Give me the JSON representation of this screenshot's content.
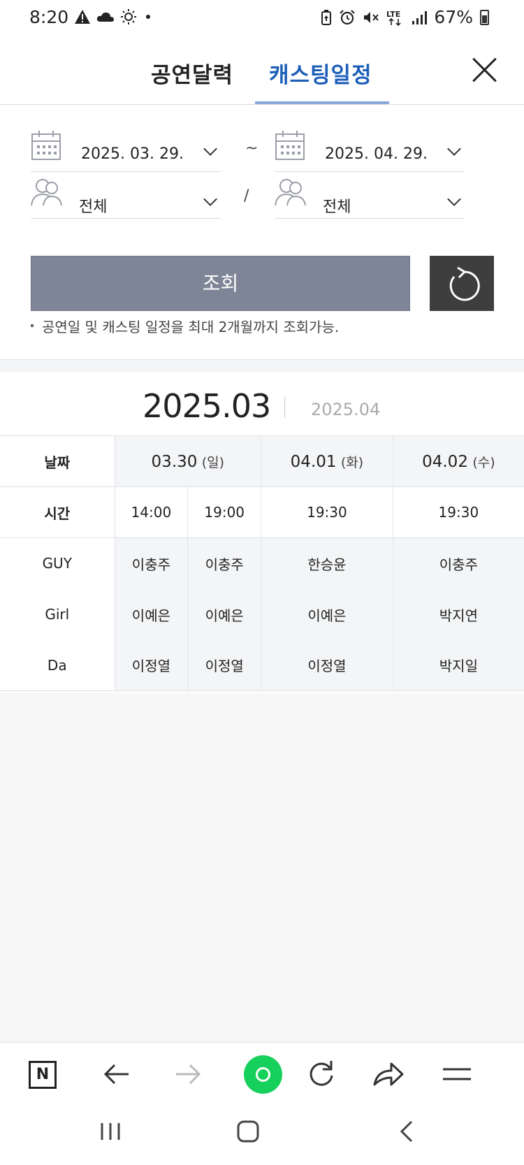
{
  "status": {
    "time": "8:20",
    "left_icons": [
      "warning-icon",
      "cloud-icon",
      "sun-icon",
      "dot-icon"
    ],
    "right_icons": [
      "battery-saver-icon",
      "alarm-icon",
      "mute-icon",
      "lte-icon",
      "signal-icon"
    ],
    "network": "LTE",
    "battery": "67%"
  },
  "tabs": [
    {
      "label": "공연달력",
      "active": false
    },
    {
      "label": "캐스팅일정",
      "active": true
    }
  ],
  "filter": {
    "start_date": "2025. 03. 29.",
    "end_date": "2025. 04. 29.",
    "range_separator": "~",
    "cast_separator": "/",
    "cast_from": "전체",
    "cast_to": "전체",
    "search_label": "조회",
    "note": "공연일 및 캐스팅 일정을 최대 2개월까지 조회가능."
  },
  "months": {
    "current": "2025.03",
    "next": "2025.04"
  },
  "schedule": {
    "row_headers": {
      "date": "날짜",
      "time": "시간"
    },
    "dates": [
      {
        "date": "03.30",
        "dow": "(일)"
      },
      {
        "date": "04.01",
        "dow": "(화)"
      },
      {
        "date": "04.02",
        "dow": "(수)"
      }
    ],
    "times": [
      "14:00",
      "19:00",
      "19:30",
      "19:30"
    ],
    "roles": [
      {
        "role": "GUY",
        "cast": [
          "이충주",
          "이충주",
          "한승윤",
          "이충주"
        ]
      },
      {
        "role": "Girl",
        "cast": [
          "이예은",
          "이예은",
          "이예은",
          "박지연"
        ]
      },
      {
        "role": "Da",
        "cast": [
          "이정열",
          "이정열",
          "이정열",
          "박지일"
        ]
      }
    ]
  },
  "toolbar": {
    "home_label": "N"
  },
  "colors": {
    "active_tab": "#1d5fb8",
    "search_button": "#7e8596",
    "reset_button": "#3e3e3e",
    "green_button": "#15d05a"
  }
}
